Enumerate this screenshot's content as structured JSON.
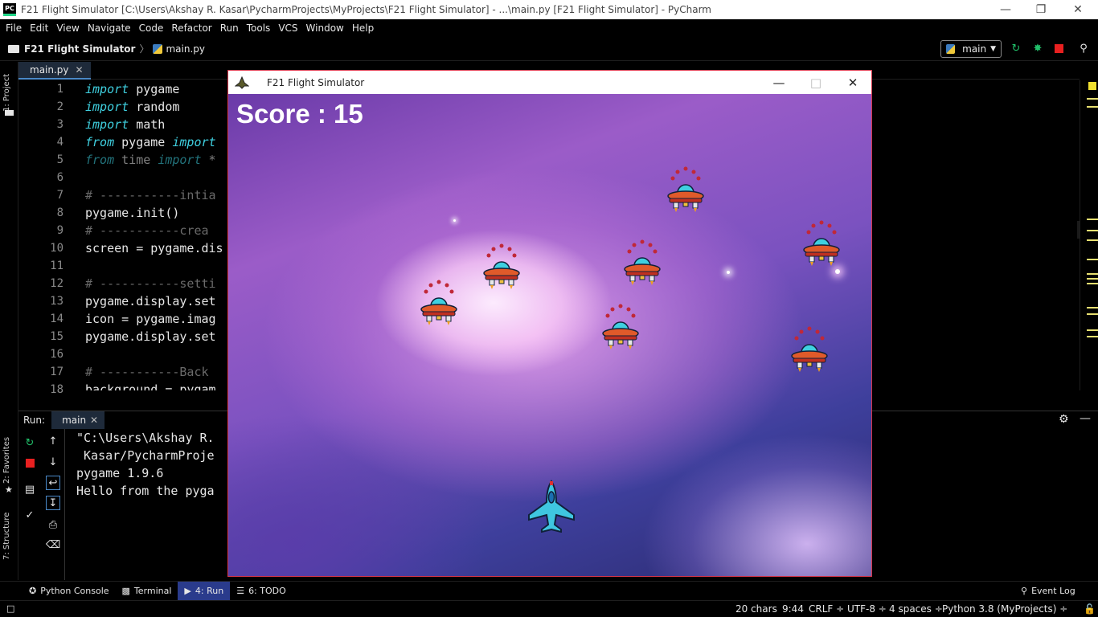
{
  "window": {
    "title": "F21 Flight Simulator [C:\\Users\\Akshay R. Kasar\\PycharmProjects\\MyProjects\\F21 Flight Simulator] - ...\\main.py [F21 Flight Simulator] - PyCharm",
    "app_icon_text": "PC"
  },
  "menu": [
    "File",
    "Edit",
    "View",
    "Navigate",
    "Code",
    "Refactor",
    "Run",
    "Tools",
    "VCS",
    "Window",
    "Help"
  ],
  "breadcrumb": {
    "project": "F21 Flight Simulator",
    "file": "main.py"
  },
  "run_config": {
    "name": "main"
  },
  "left_tabs": {
    "project": "1: Project",
    "favorites": "2: Favorites",
    "structure": "7: Structure"
  },
  "editor": {
    "tab_label": "main.py",
    "line_numbers": [
      "1",
      "2",
      "3",
      "4",
      "5",
      "6",
      "7",
      "8",
      "9",
      "10",
      "11",
      "12",
      "13",
      "14",
      "15",
      "16",
      "17",
      "18"
    ],
    "lines": [
      {
        "kw": "import",
        "rest": " pygame"
      },
      {
        "kw": "import",
        "rest": " random"
      },
      {
        "kw": "import",
        "rest": " math"
      },
      {
        "kw": "from",
        "rest": " pygame ",
        "kw2": "import"
      },
      {
        "kw": "from",
        "rest": " time ",
        "kw2": "import",
        "rest2": " *"
      },
      {
        "text": ""
      },
      {
        "comment": "# -----------intia"
      },
      {
        "text": "pygame.init()"
      },
      {
        "comment": "# -----------crea"
      },
      {
        "text": "screen = pygame.dis"
      },
      {
        "text": ""
      },
      {
        "comment": "# -----------setti"
      },
      {
        "text": "pygame.display.set"
      },
      {
        "text": "icon = pygame.imag"
      },
      {
        "text": "pygame.display.set"
      },
      {
        "text": ""
      },
      {
        "comment": "# -----------Back"
      },
      {
        "text": "background = pygam"
      }
    ]
  },
  "run_panel": {
    "label": "Run:",
    "tab": "main",
    "output": [
      "\"C:\\Users\\Akshay R.",
      " Kasar/PycharmProje",
      "pygame 1.9.6",
      "Hello from the pyga"
    ]
  },
  "bottom_tools": [
    {
      "label": "Python Console",
      "active": false
    },
    {
      "label": "Terminal",
      "active": false
    },
    {
      "label": "4: Run",
      "active": true
    },
    {
      "label": "6: TODO",
      "active": false
    }
  ],
  "event_log": "Event Log",
  "status": {
    "chars": "20 chars",
    "position": "9:44",
    "line_sep": "CRLF ÷",
    "encoding": "UTF-8 ÷",
    "indent": "4 spaces ÷",
    "interpreter": "Python 3.8 (MyProjects) ÷"
  },
  "game": {
    "title": "F21 Flight Simulator",
    "score_text": "Score : 15",
    "enemy_count": 7
  },
  "colors": {
    "keyword": "#3fd0e0",
    "comment": "#6a6a6a",
    "run_active": "#2a3b8c",
    "game_border": "#d7364a",
    "stop": "#e82020",
    "rerun": "#21c06a"
  }
}
